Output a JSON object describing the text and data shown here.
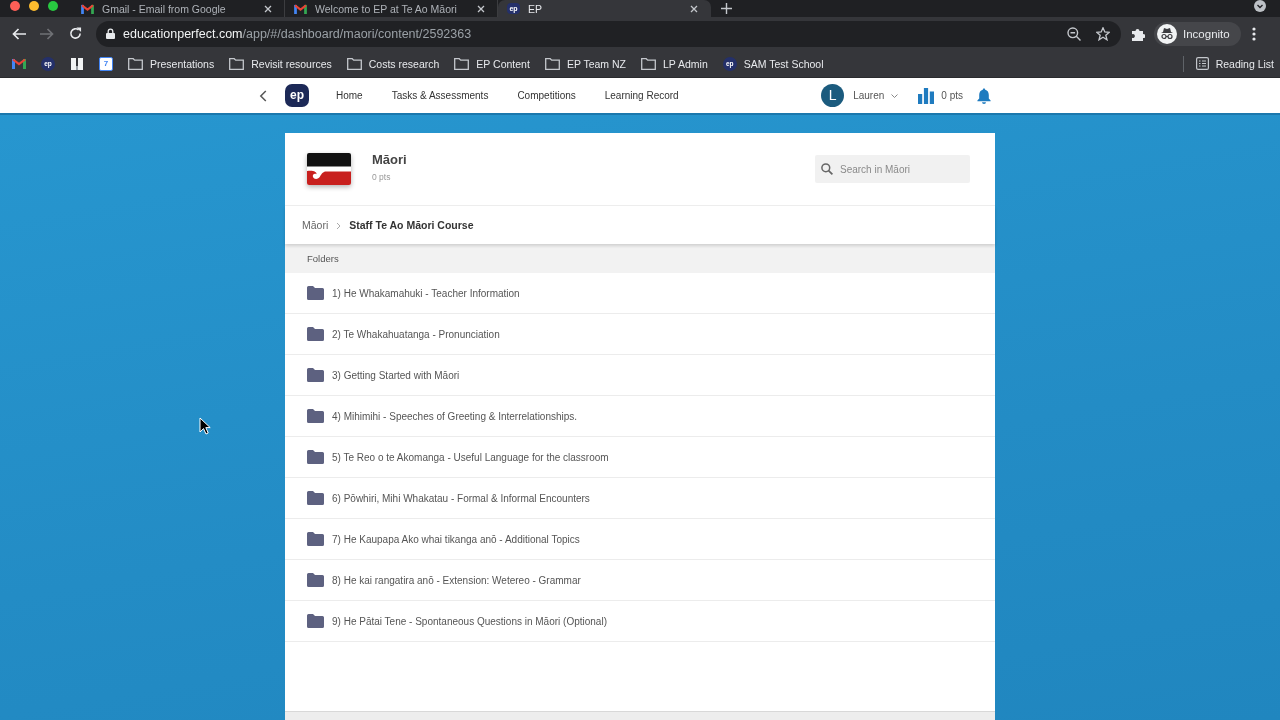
{
  "browser": {
    "tabs": [
      {
        "title": "Gmail - Email from Google",
        "kind": "mail",
        "selected": false
      },
      {
        "title": "Welcome to EP at Te Ao Māori",
        "kind": "mail",
        "selected": false
      },
      {
        "title": "EP",
        "kind": "ep",
        "badge": "ep",
        "selected": true
      }
    ],
    "nav_buttons": [
      {
        "kind": "back",
        "disabled": false
      },
      {
        "kind": "forward",
        "disabled": true
      },
      {
        "kind": "reload",
        "disabled": false
      }
    ],
    "address": {
      "domain": "educationperfect.com",
      "path": "/app/#/dashboard/maori/content/2592363"
    },
    "profile": "Incognito",
    "bookmarks": [
      {
        "kind": "mail"
      },
      {
        "kind": "ep",
        "badge": "ep"
      },
      {
        "kind": "book"
      },
      {
        "kind": "calendar",
        "badge": "7"
      },
      {
        "kind": "folder",
        "label": "Presentations"
      },
      {
        "kind": "folder",
        "label": "Revisit resources"
      },
      {
        "kind": "folder",
        "label": "Costs research"
      },
      {
        "kind": "folder",
        "label": "EP Content"
      },
      {
        "kind": "folder",
        "label": "EP Team NZ"
      },
      {
        "kind": "folder",
        "label": "LP Admin"
      },
      {
        "kind": "ep",
        "badge": "ep",
        "label": "SAM Test School"
      }
    ],
    "reading_list": "Reading List"
  },
  "app_nav": {
    "logo": "ep",
    "links": [
      "Home",
      "Tasks & Assessments",
      "Competitions",
      "Learning Record"
    ],
    "user": {
      "initial": "L",
      "name": "Lauren"
    },
    "points": "0 pts"
  },
  "course": {
    "title": "Māori",
    "points": "0 pts",
    "search": {
      "placeholder": "Search in Māori"
    },
    "breadcrumb": [
      {
        "label": "Māori",
        "current": false
      },
      {
        "label": "Staff Te Ao Māori Course",
        "current": true
      }
    ],
    "section": "Folders",
    "folders": [
      "1) He Whakamahuki - Teacher Information",
      "2) Te Whakahuatanga - Pronunciation",
      "3) Getting Started with Māori",
      "4) Mihimihi - Speeches of Greeting & Interrelationships.",
      "5) Te Reo o te Akomanga - Useful Language for the classroom",
      "6) Pōwhiri, Mihi Whakatau - Formal & Informal Encounters",
      "7) He Kaupapa Ako whai tikanga anō - Additional Topics",
      "8) He kai rangatira anō - Extension: Wetereo - Grammar",
      "9) He Pātai Tene - Spontaneous Questions in Māori (Optional)"
    ]
  }
}
